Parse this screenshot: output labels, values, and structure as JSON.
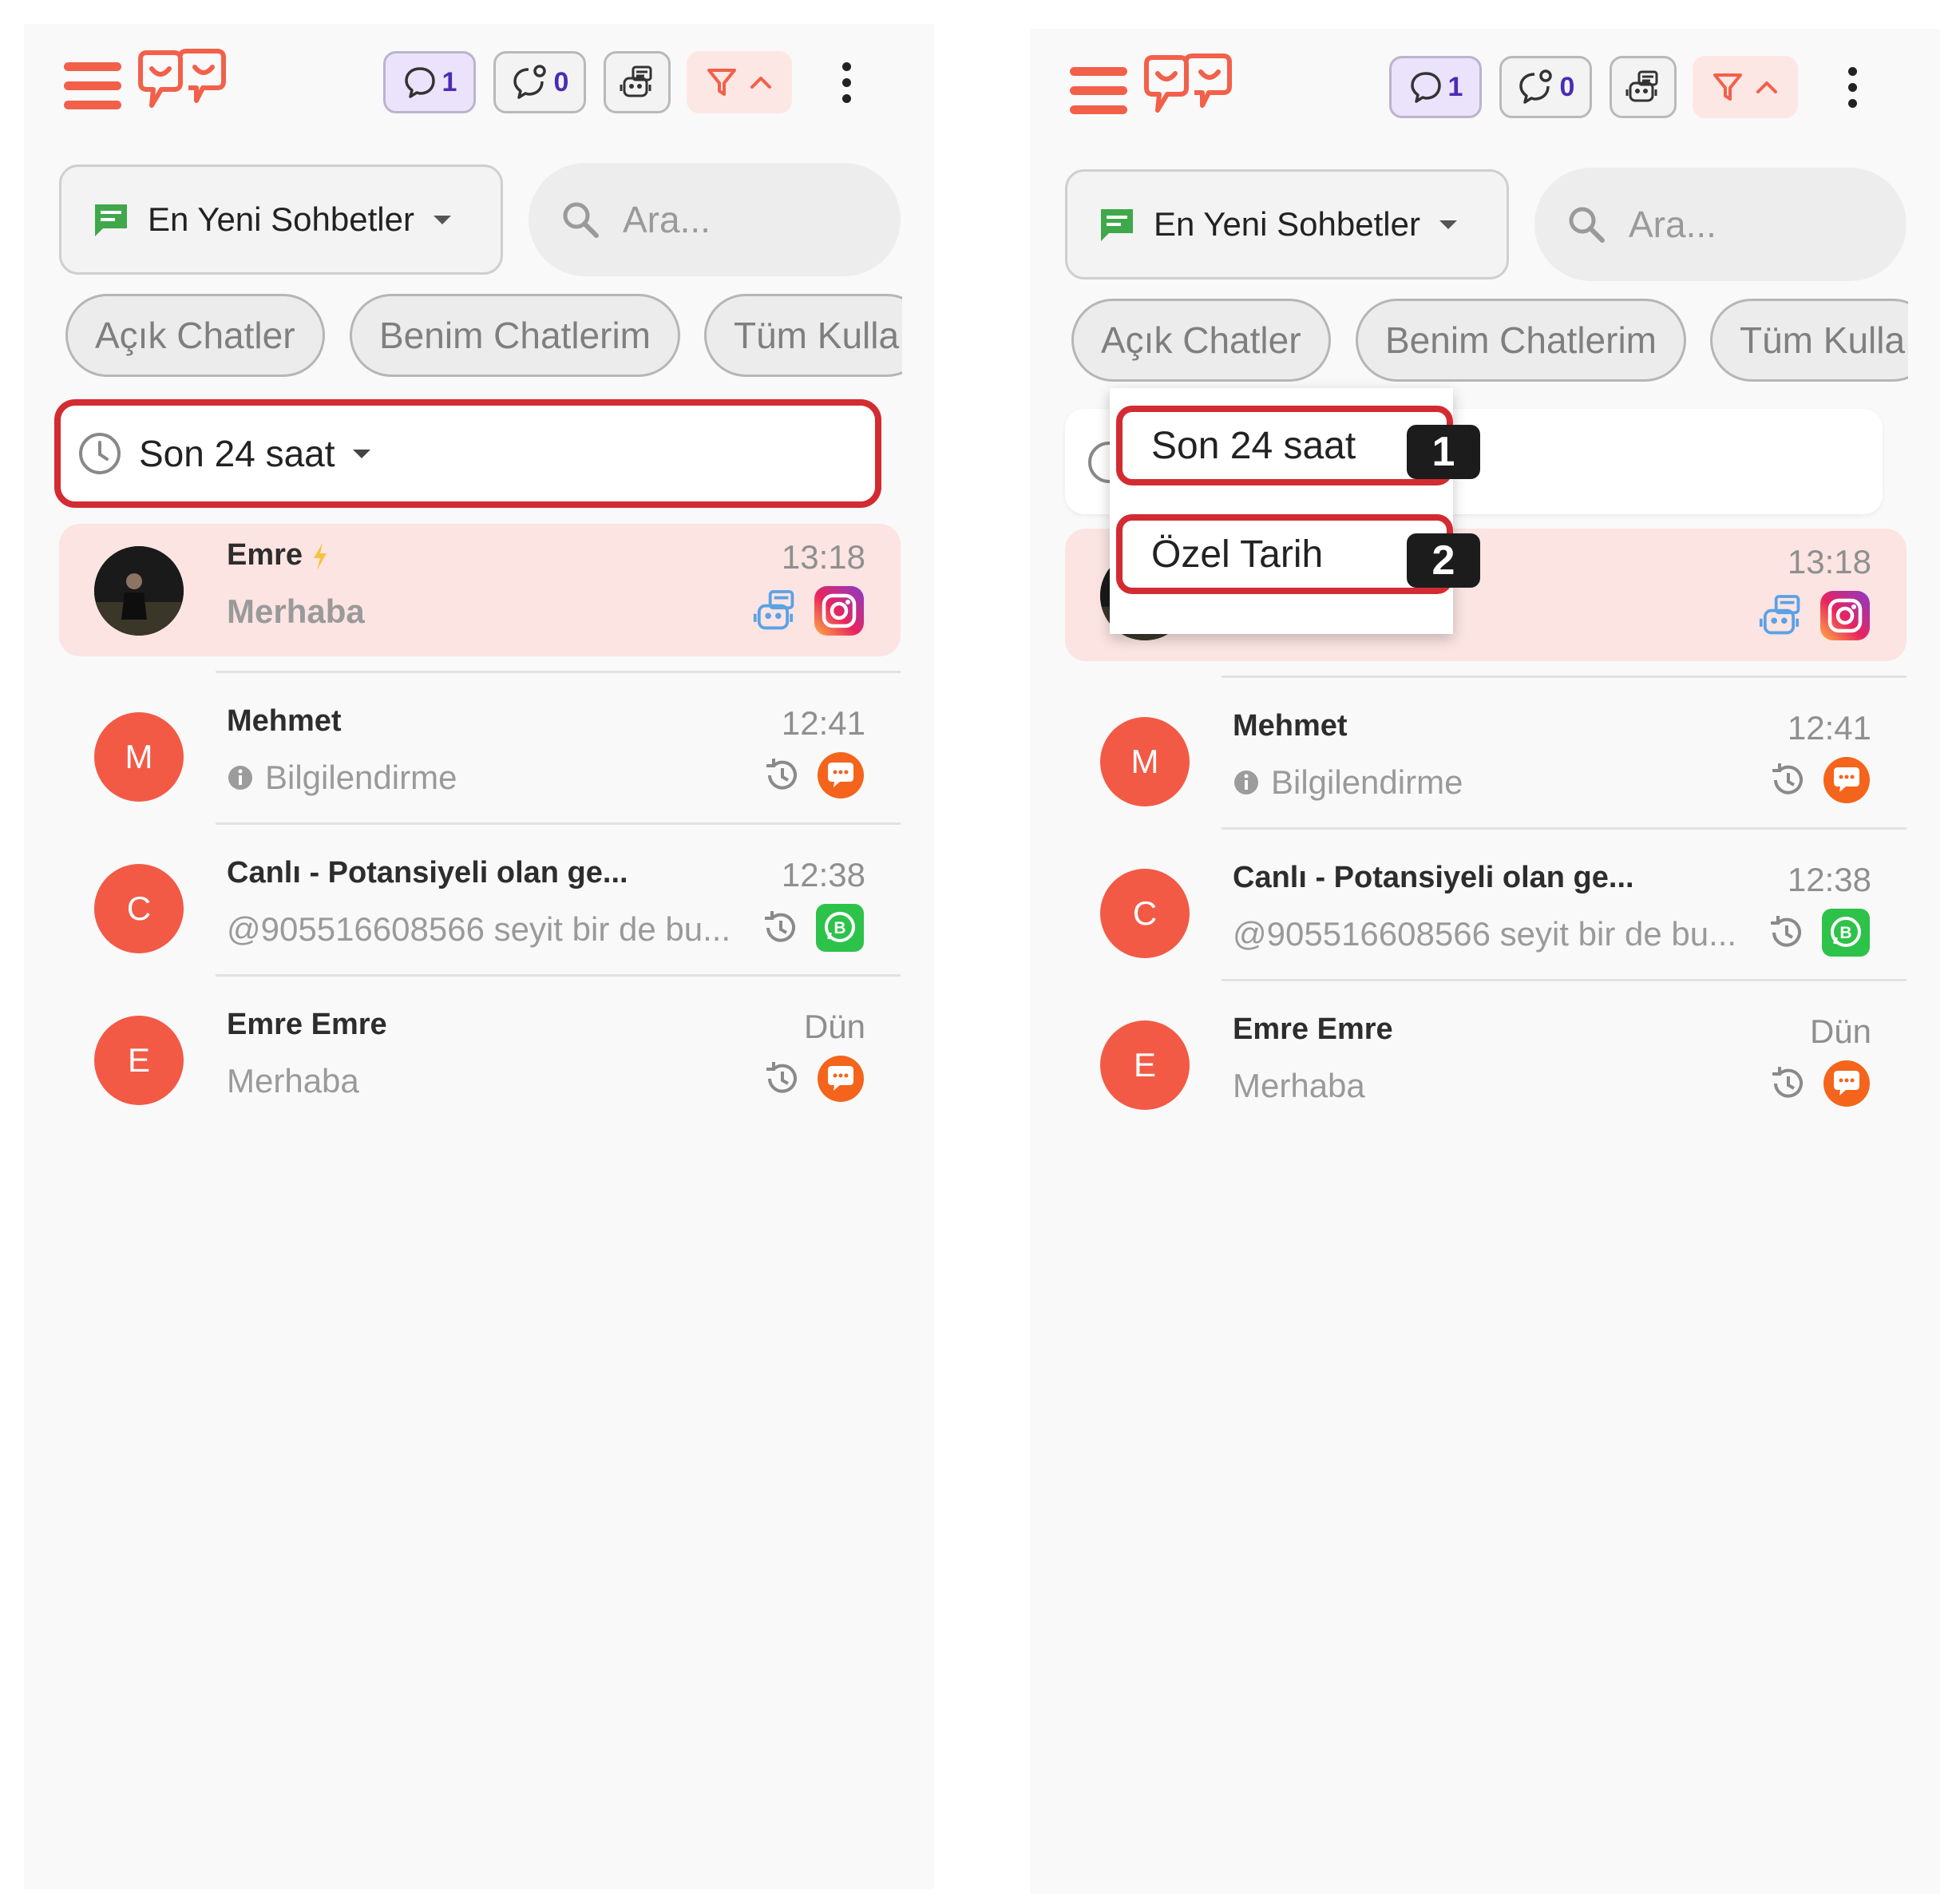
{
  "header": {
    "open_count": "1",
    "pending_count": "0",
    "icons": [
      "menu-icon",
      "logo-icon",
      "chat-bubble-icon",
      "pending-chat-icon",
      "bot-icon",
      "filter-icon",
      "chevron-up-icon",
      "more-vert-icon"
    ]
  },
  "sort": {
    "label": "En Yeni Sohbetler"
  },
  "search": {
    "placeholder": "Ara..."
  },
  "chips": [
    "Açık Chatler",
    "Benim Chatlerim",
    "Tüm Kulla"
  ],
  "date_filter": {
    "label": "Son 24 saat"
  },
  "conversations": [
    {
      "name": "Emre",
      "time": "13:18",
      "message": "Merhaba",
      "channel": "instagram",
      "avatar": ""
    },
    {
      "name": "Mehmet",
      "time": "12:41",
      "message": "Bilgilendirme",
      "channel": "livechat",
      "avatar": "M"
    },
    {
      "name": "Canlı - Potansiyeli olan ge...",
      "time": "12:38",
      "message": "@905516608566 seyit bir de bu...",
      "channel": "whatsapp-business",
      "avatar": "C"
    },
    {
      "name": "Emre Emre",
      "time": "Dün",
      "message": "Merhaba",
      "channel": "livechat",
      "avatar": "E"
    }
  ],
  "dropdown": {
    "items": [
      {
        "label": "Son 24 saat",
        "step": "1"
      },
      {
        "label": "Özel Tarih",
        "step": "2"
      }
    ]
  },
  "colors": {
    "accent": "#f2604a",
    "highlight": "#d32b32",
    "active_row": "#fbe4e2",
    "open_badge": "#ebe3fb"
  }
}
